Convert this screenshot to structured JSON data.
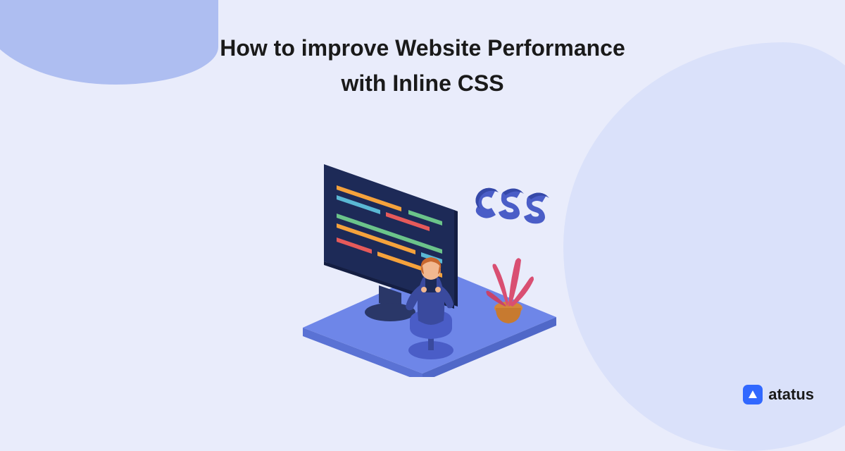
{
  "title": "How to improve Website Performance with Inline CSS",
  "decorative_text": "CSS",
  "brand": {
    "name": "atatus"
  },
  "colors": {
    "background": "#e9ecfb",
    "blob_left": "#aebef1",
    "blob_right": "#dae1fa",
    "platform": "#6e86e8",
    "screen": "#1d2a57",
    "brand_blue": "#3168ff",
    "css_text": "#4a5dc7",
    "line_orange": "#f5a23c",
    "line_green": "#6bc48a",
    "line_cyan": "#5ab8d4",
    "line_red": "#e65a5a",
    "plant": "#d94f72"
  }
}
